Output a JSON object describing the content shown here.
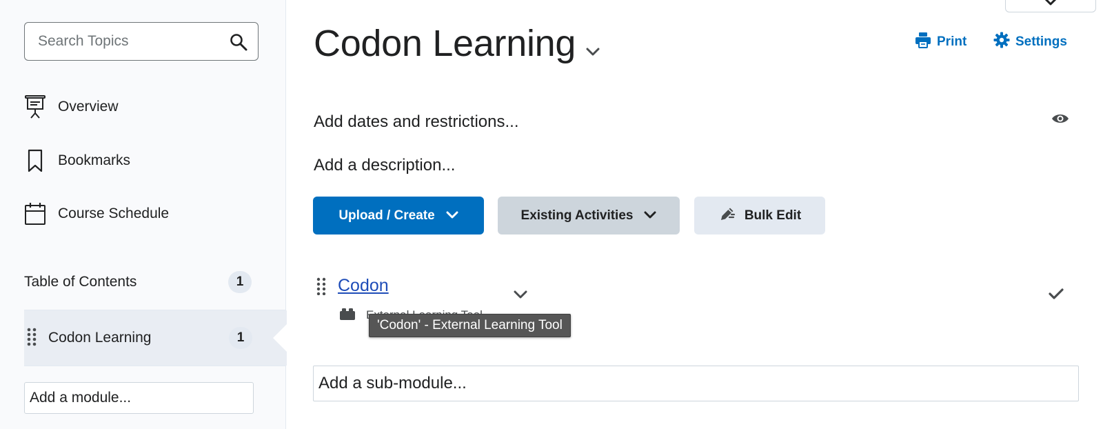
{
  "sidebar": {
    "search": {
      "placeholder": "Search Topics",
      "value": ""
    },
    "nav": [
      {
        "label": "Overview",
        "icon": "presentation-icon"
      },
      {
        "label": "Bookmarks",
        "icon": "bookmark-icon"
      },
      {
        "label": "Course Schedule",
        "icon": "calendar-icon"
      }
    ],
    "toc": {
      "label": "Table of Contents",
      "count": "1"
    },
    "module": {
      "label": "Codon Learning",
      "count": "1",
      "selected": true
    },
    "add_module": "Add a module..."
  },
  "main": {
    "title": "Codon Learning",
    "print_label": "Print",
    "settings_label": "Settings",
    "dates_restrictions": "Add dates and restrictions...",
    "description": "Add a description...",
    "buttons": {
      "upload_create": "Upload / Create",
      "existing_activities": "Existing Activities",
      "bulk_edit": "Bulk Edit"
    },
    "topic": {
      "title": "Codon",
      "type": "External Learning Tool",
      "tooltip": "'Codon' - External Learning Tool",
      "completed": true
    },
    "add_submodule": "Add a sub-module..."
  },
  "colors": {
    "accent": "#006fbf",
    "link": "#1e4cb8",
    "sidebar_bg": "#f9fafc",
    "selected_bg": "#e9edf3",
    "text": "#202122"
  }
}
